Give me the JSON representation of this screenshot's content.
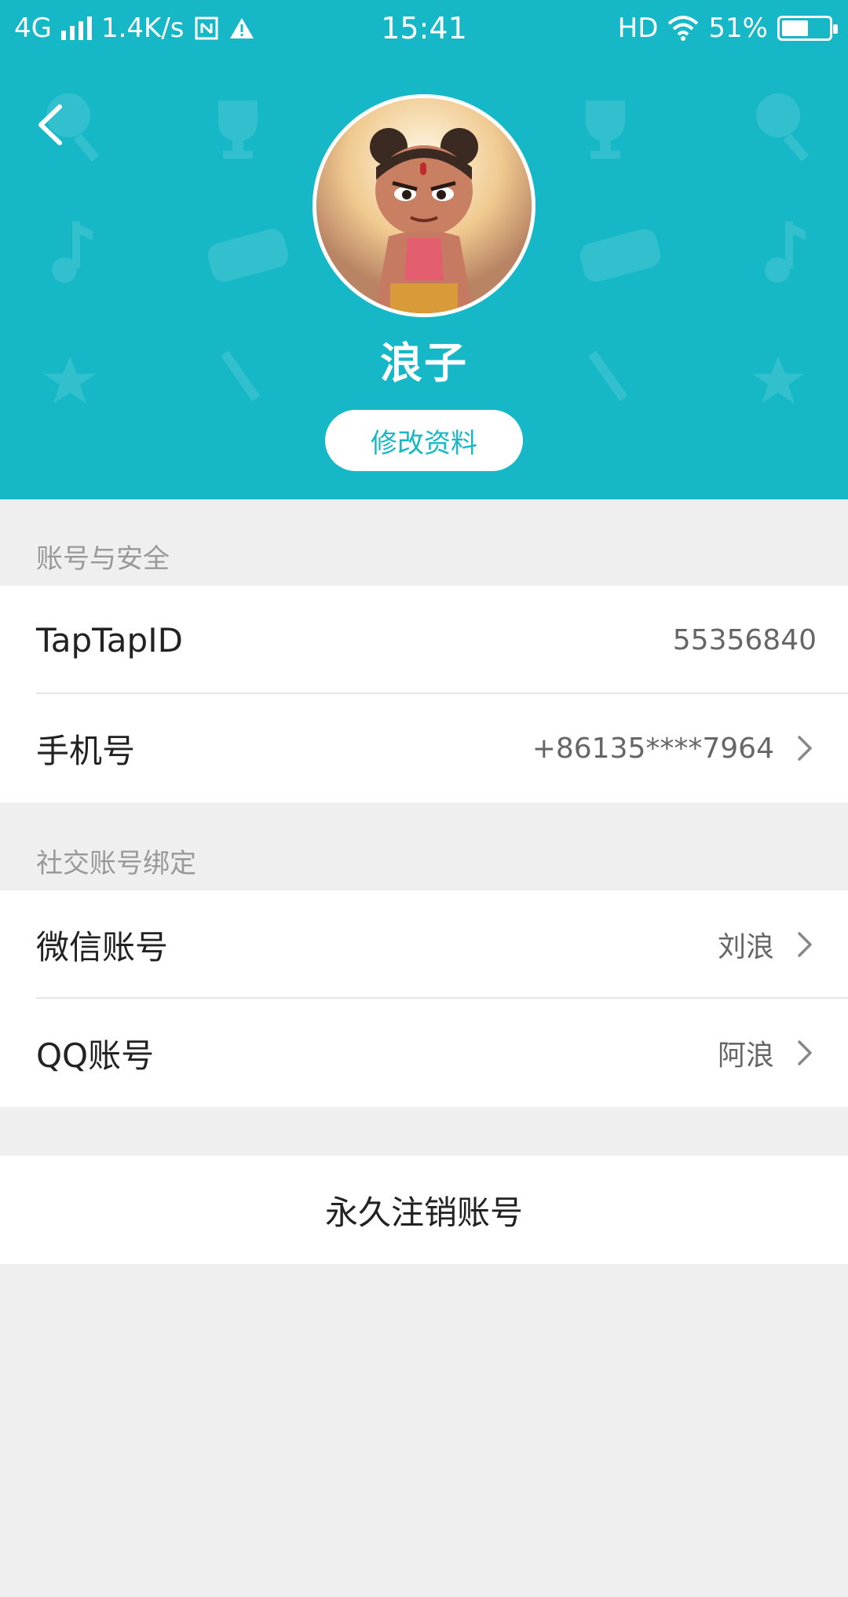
{
  "status_bar": {
    "network": "4G",
    "speed": "1.4K/s",
    "time": "15:41",
    "hd": "HD",
    "battery": "51%"
  },
  "profile": {
    "nickname": "浪子",
    "edit_label": "修改资料"
  },
  "sections": {
    "account_title": "账号与安全",
    "social_title": "社交账号绑定"
  },
  "account_rows": [
    {
      "label": "TapTapID",
      "value": "55356840"
    },
    {
      "label": "手机号",
      "value": "+86135****7964"
    }
  ],
  "social_rows": [
    {
      "label": "微信账号",
      "value": "刘浪"
    },
    {
      "label": "QQ账号",
      "value": "阿浪"
    }
  ],
  "delete_account_label": "永久注销账号",
  "colors": {
    "accent": "#16b8c7",
    "background": "#efefef"
  }
}
